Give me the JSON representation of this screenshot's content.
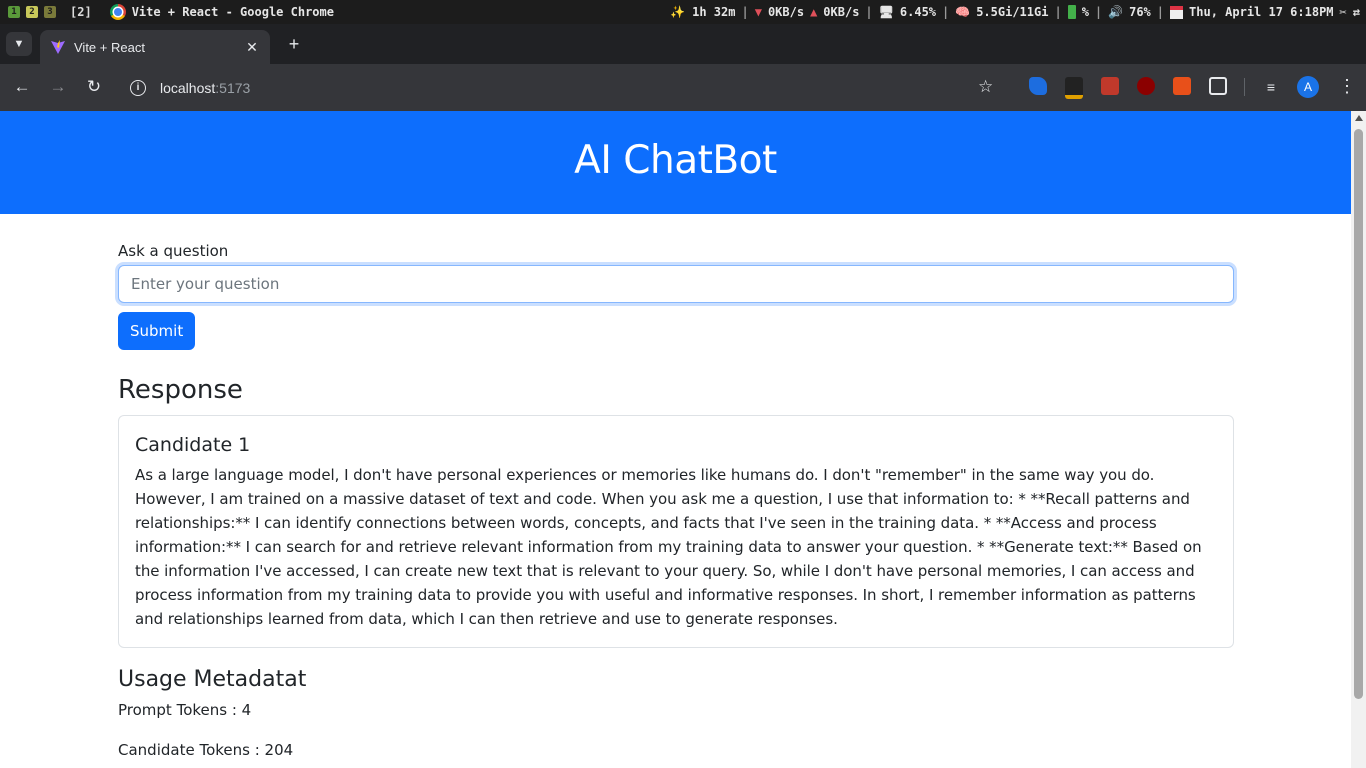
{
  "os_bar": {
    "workspaces": [
      "1",
      "2",
      "3"
    ],
    "group": "[2]",
    "window_title": "Vite + React - Google Chrome",
    "uptime": "✨ 1h 32m",
    "net_down": "0KB/s",
    "net_up": "0KB/s",
    "cpu": "6.45%",
    "memory": "5.5Gi/11Gi",
    "battery": "%",
    "volume": "76%",
    "datetime": "Thu, April 17 6:18PM",
    "separator": "|"
  },
  "browser": {
    "tab_title": "Vite + React",
    "url_host": "localhost",
    "url_port": ":5173",
    "avatar_letter": "A"
  },
  "page": {
    "header_title": "AI ChatBot",
    "question_label": "Ask a question",
    "question_placeholder": "Enter your question",
    "question_value": "",
    "submit_label": "Submit",
    "response_heading": "Response",
    "candidates": [
      {
        "title": "Candidate 1",
        "text": "As a large language model, I don't have personal experiences or memories like humans do. I don't \"remember\" in the same way you do. However, I am trained on a massive dataset of text and code. When you ask me a question, I use that information to: * **Recall patterns and relationships:** I can identify connections between words, concepts, and facts that I've seen in the training data. * **Access and process information:** I can search for and retrieve relevant information from my training data to answer your question. * **Generate text:** Based on the information I've accessed, I can create new text that is relevant to your query. So, while I don't have personal memories, I can access and process information from my training data to provide you with useful and informative responses. In short, I remember information as patterns and relationships learned from data, which I can then retrieve and use to generate responses."
      }
    ],
    "usage_heading": "Usage Metadatat",
    "prompt_tokens": "Prompt Tokens : 4",
    "candidate_tokens": "Candidate Tokens : 204"
  },
  "colors": {
    "header_bg": "#0d6efd",
    "button_bg": "#0d6efd",
    "browser_dark": "#35363a"
  }
}
